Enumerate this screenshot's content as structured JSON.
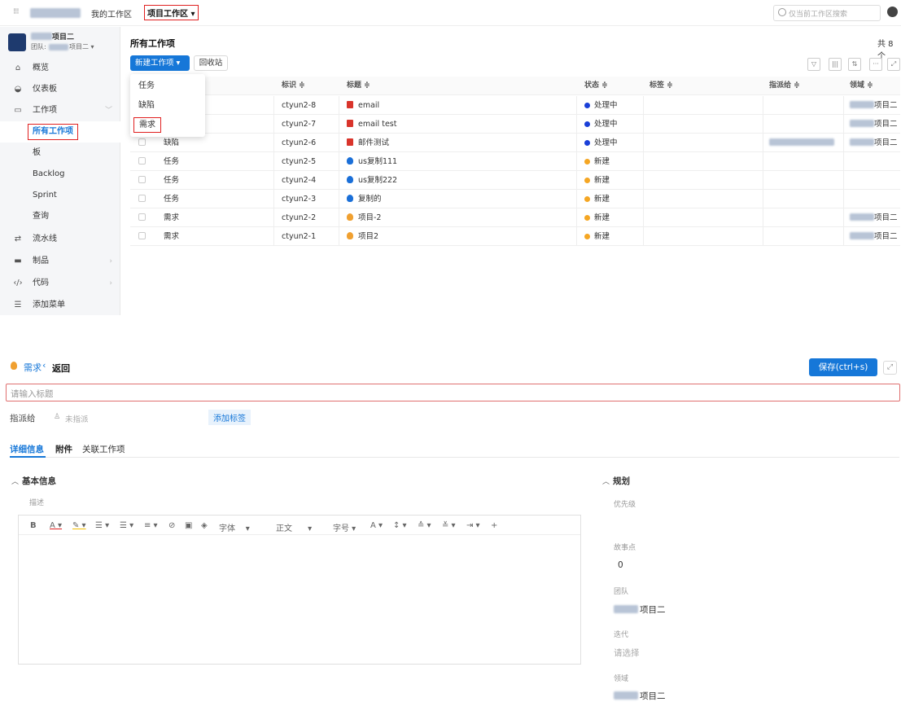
{
  "topbar": {
    "apps_icon": "grid-icon",
    "my_workspace": "我的工作区",
    "project_workspace": "项目工作区",
    "search_placeholder": "仅当前工作区搜索"
  },
  "sidebar": {
    "project_name": "项目二",
    "team_label": "团队:",
    "team_value": "项目二",
    "items": [
      {
        "label": "概览",
        "icon": "home-icon"
      },
      {
        "label": "仪表板",
        "icon": "dashboard-icon"
      },
      {
        "label": "工作项",
        "icon": "workitem-icon"
      },
      {
        "label": "所有工作项"
      },
      {
        "label": "板"
      },
      {
        "label": "Backlog"
      },
      {
        "label": "Sprint"
      },
      {
        "label": "查询"
      },
      {
        "label": "流水线",
        "icon": "pipeline-icon"
      },
      {
        "label": "制品",
        "icon": "artifact-icon"
      },
      {
        "label": "代码",
        "icon": "code-icon"
      },
      {
        "label": "添加菜单",
        "icon": "menu-icon"
      }
    ]
  },
  "main": {
    "title": "所有工作项",
    "count": "共 8 个",
    "new_button": "新建工作项",
    "recycle_button": "回收站",
    "dropdown": [
      "任务",
      "缺陷",
      "需求"
    ],
    "columns": {
      "id": "标识",
      "title": "标题",
      "status": "状态",
      "tags": "标签",
      "assignee": "指派给",
      "domain": "领域"
    },
    "rows": [
      {
        "type": "",
        "id": "ctyun2-8",
        "title": "email",
        "status": "处理中",
        "domain": "项目二",
        "icon": "bug-icon"
      },
      {
        "type": "",
        "id": "ctyun2-7",
        "title": "email test",
        "status": "处理中",
        "domain": "项目二",
        "icon": "bug-icon"
      },
      {
        "type": "缺陷",
        "id": "ctyun2-6",
        "title": "邮件测试",
        "status": "处理中",
        "domain": "项目二",
        "icon": "bug-icon"
      },
      {
        "type": "任务",
        "id": "ctyun2-5",
        "title": "us复制111",
        "status": "新建",
        "domain": "",
        "icon": "task-icon"
      },
      {
        "type": "任务",
        "id": "ctyun2-4",
        "title": "us复制222",
        "status": "新建",
        "domain": "",
        "icon": "task-icon"
      },
      {
        "type": "任务",
        "id": "ctyun2-3",
        "title": "复制的",
        "status": "新建",
        "domain": "",
        "icon": "task-icon"
      },
      {
        "type": "需求",
        "id": "ctyun2-2",
        "title": "项目-2",
        "status": "新建",
        "domain": "项目二",
        "icon": "story-icon"
      },
      {
        "type": "需求",
        "id": "ctyun2-1",
        "title": "项目2",
        "status": "新建",
        "domain": "项目二",
        "icon": "story-icon"
      }
    ]
  },
  "form": {
    "type_label": "需求",
    "back_label": "返回",
    "save_button": "保存(ctrl+s)",
    "title_placeholder": "请输入标题",
    "assignee_label": "指派给",
    "assignee_value": "未指派",
    "add_tag": "添加标签",
    "tabs": [
      "详细信息",
      "附件",
      "关联工作项"
    ],
    "basic_info": "基本信息",
    "description": "描述",
    "toolbar": {
      "font": "字体",
      "body": "正文",
      "size": "字号"
    },
    "planning": "规划",
    "priority": "优先级",
    "story_points": "故事点",
    "story_points_value": "0",
    "team": "团队",
    "team_value": "项目二",
    "iteration": "迭代",
    "iteration_placeholder": "请选择",
    "domain": "领域",
    "domain_value": "项目二"
  },
  "colors": {
    "accent": "#1677d8",
    "processing": "#1a3fd8",
    "new": "#f5a623",
    "highlight": "#e02020"
  }
}
